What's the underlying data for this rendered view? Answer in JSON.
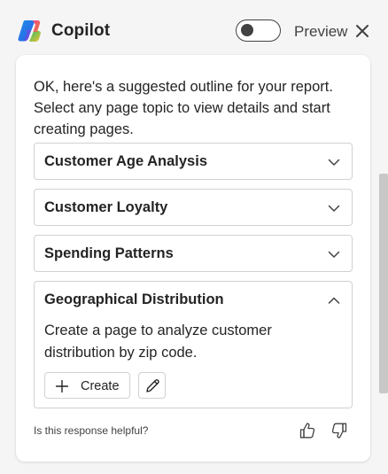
{
  "header": {
    "title": "Copilot",
    "preview_label": "Preview",
    "preview_toggle_on": false,
    "logo_icon": "copilot-logo",
    "close_icon": "close-icon"
  },
  "message": {
    "intro": "OK, here's a suggested outline for your report. Select any page topic to view details and start creating pages.",
    "topics": [
      {
        "title": "Customer Age Analysis",
        "expanded": false
      },
      {
        "title": "Customer Loyalty",
        "expanded": false
      },
      {
        "title": "Spending Patterns",
        "expanded": false
      },
      {
        "title": "Geographical Distribution",
        "expanded": true,
        "description": "Create a page to analyze customer distribution by zip code.",
        "create_label": "Create",
        "edit_icon": "pencil-icon"
      }
    ]
  },
  "feedback": {
    "question": "Is this response helpful?",
    "like_icon": "thumbs-up-icon",
    "dislike_icon": "thumbs-down-icon"
  },
  "colors": {
    "background": "#f5f5f5",
    "card": "#ffffff",
    "border": "#d1d1d1",
    "text": "#242424"
  }
}
